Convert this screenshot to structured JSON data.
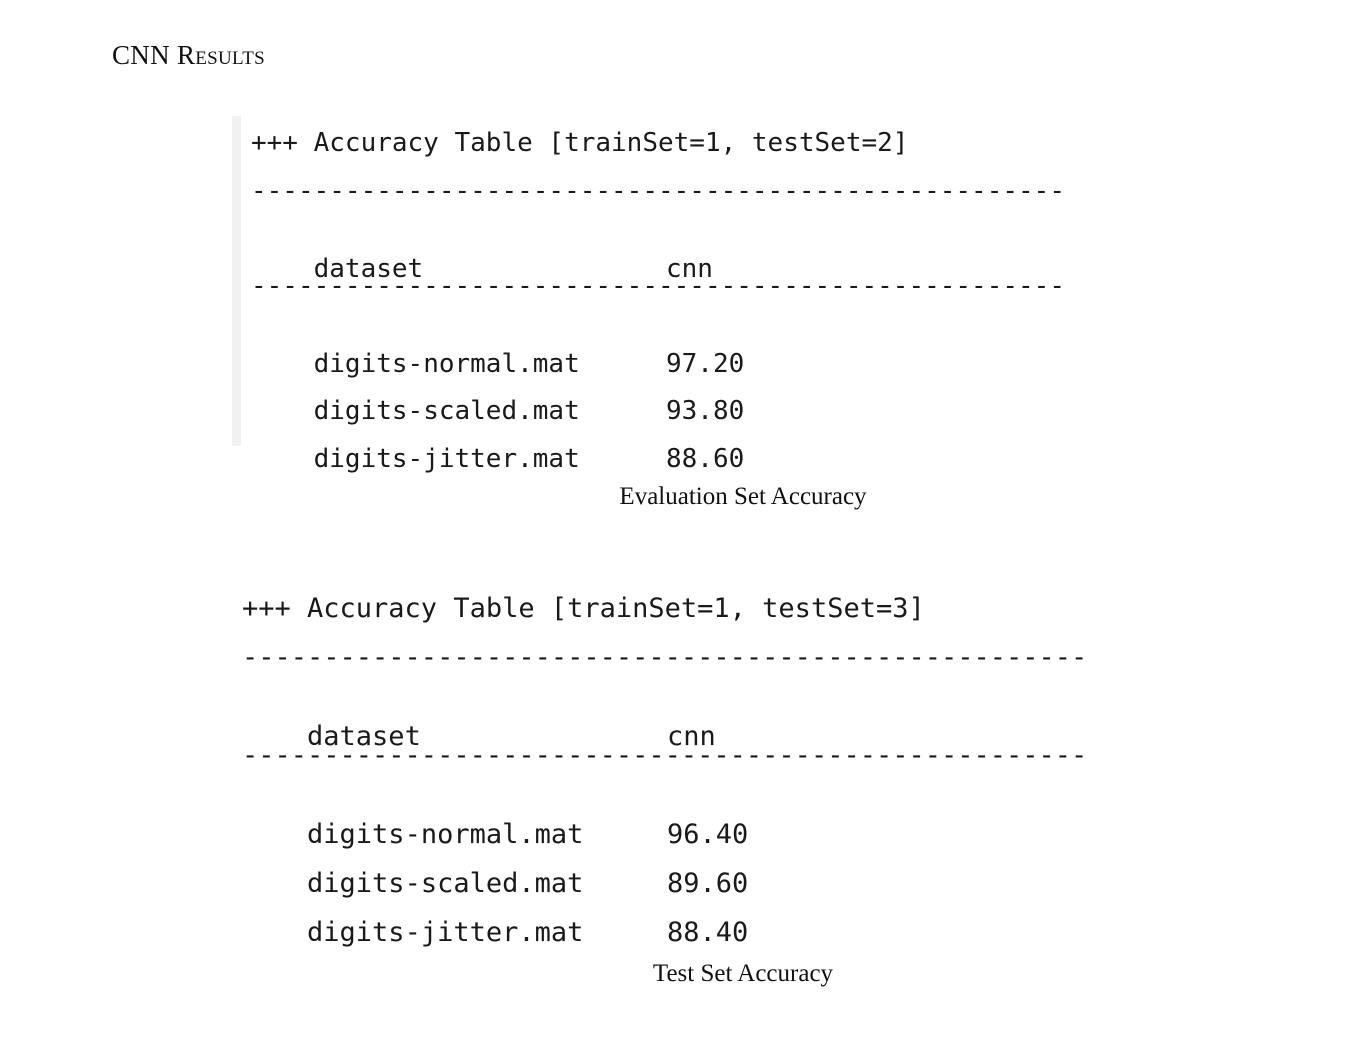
{
  "section_title": "CNN Results",
  "tables": [
    {
      "header": "+++ Accuracy Table [trainSet=1, testSet=2]",
      "divider": "----------------------------------------------------",
      "columns": [
        "dataset",
        "cnn"
      ],
      "rows": [
        {
          "dataset": "digits-normal.mat",
          "cnn": "97.20"
        },
        {
          "dataset": "digits-scaled.mat",
          "cnn": "93.80"
        },
        {
          "dataset": "digits-jitter.mat",
          "cnn": "88.60"
        }
      ],
      "caption": "Evaluation Set Accuracy"
    },
    {
      "header": "+++ Accuracy Table [trainSet=1, testSet=3]",
      "divider": "----------------------------------------------------",
      "columns": [
        "dataset",
        "cnn"
      ],
      "rows": [
        {
          "dataset": "digits-normal.mat",
          "cnn": "96.40"
        },
        {
          "dataset": "digits-scaled.mat",
          "cnn": "89.60"
        },
        {
          "dataset": "digits-jitter.mat",
          "cnn": "88.40"
        }
      ],
      "caption": "Test Set Accuracy"
    }
  ]
}
